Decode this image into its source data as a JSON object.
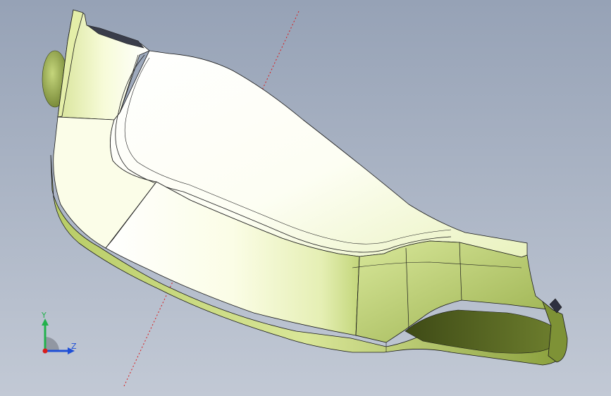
{
  "viewport": {
    "background_top": "#96a2b6",
    "background_bottom": "#c2c9d5"
  },
  "model": {
    "body_color": "#f7fbe4",
    "shadow_color": "#a9bf5a",
    "edge_color": "#1a1a1a",
    "axis_line_color": "#d81d1d"
  },
  "triad": {
    "y_label": "Y",
    "z_label": "Z",
    "y_color": "#22b14c",
    "z_color": "#1f4fd6",
    "x_color": "#d81d1d"
  }
}
